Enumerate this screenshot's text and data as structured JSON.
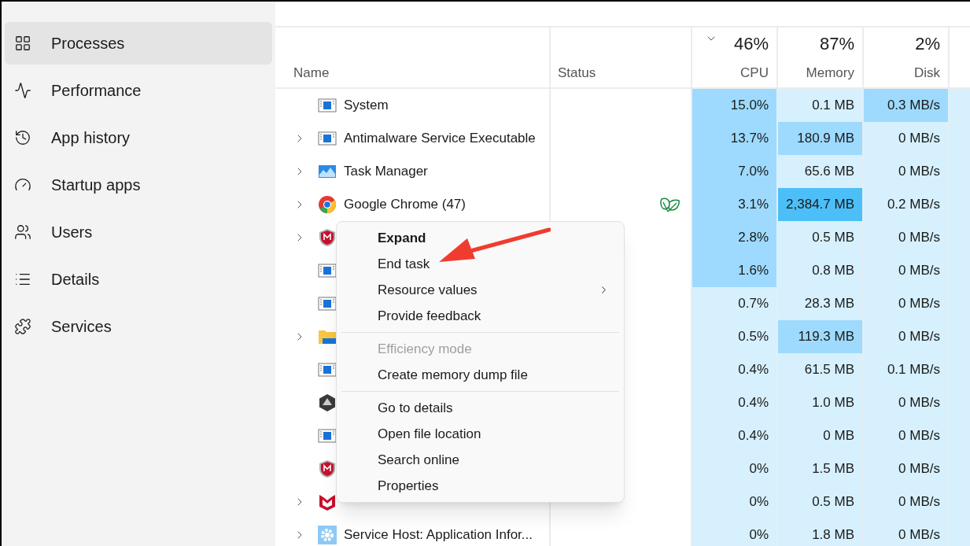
{
  "sidebar": {
    "items": [
      {
        "label": "Processes",
        "selected": true
      },
      {
        "label": "Performance",
        "selected": false
      },
      {
        "label": "App history",
        "selected": false
      },
      {
        "label": "Startup apps",
        "selected": false
      },
      {
        "label": "Users",
        "selected": false
      },
      {
        "label": "Details",
        "selected": false
      },
      {
        "label": "Services",
        "selected": false
      }
    ]
  },
  "table": {
    "columns": [
      {
        "label": "Name",
        "kind": "name"
      },
      {
        "label": "Status",
        "kind": "status"
      },
      {
        "label": "CPU",
        "total": "46%",
        "kind": "metric",
        "sorted": true
      },
      {
        "label": "Memory",
        "total": "87%",
        "kind": "metric",
        "sorted": false
      },
      {
        "label": "Disk",
        "total": "2%",
        "kind": "metric",
        "sorted": false
      }
    ],
    "rows": [
      {
        "name": "System",
        "kind": "window",
        "expandable": false,
        "efficiency": false,
        "cpu": {
          "text": "15.0%",
          "color": "#9edafd"
        },
        "memory": {
          "text": "0.1 MB",
          "color": "#d6f0fd"
        },
        "disk": {
          "text": "0.3 MB/s",
          "color": "#9edafd"
        }
      },
      {
        "name": "Antimalware Service Executable",
        "kind": "window",
        "expandable": true,
        "efficiency": false,
        "cpu": {
          "text": "13.7%",
          "color": "#9edafd"
        },
        "memory": {
          "text": "180.9 MB",
          "color": "#9edafd"
        },
        "disk": {
          "text": "0 MB/s",
          "color": "#d6f0fd"
        }
      },
      {
        "name": "Task Manager",
        "kind": "chart",
        "expandable": true,
        "efficiency": false,
        "cpu": {
          "text": "7.0%",
          "color": "#9edafd"
        },
        "memory": {
          "text": "65.6 MB",
          "color": "#d6f0fd"
        },
        "disk": {
          "text": "0 MB/s",
          "color": "#d6f0fd"
        }
      },
      {
        "name": "Google Chrome (47)",
        "kind": "browser",
        "expandable": true,
        "efficiency": true,
        "cpu": {
          "text": "3.1%",
          "color": "#9edafd"
        },
        "memory": {
          "text": "2,384.7 MB",
          "color": "#4dbff8"
        },
        "disk": {
          "text": "0.2 MB/s",
          "color": "#d6f0fd"
        }
      },
      {
        "kind": "shield",
        "expandable": true,
        "efficiency": false,
        "cpu": {
          "text": "2.8%",
          "color": "#9edafd"
        },
        "memory": {
          "text": "0.5 MB",
          "color": "#d6f0fd"
        },
        "disk": {
          "text": "0 MB/s",
          "color": "#d6f0fd"
        }
      },
      {
        "kind": "window",
        "expandable": false,
        "efficiency": false,
        "cpu": {
          "text": "1.6%",
          "color": "#9edafd"
        },
        "memory": {
          "text": "0.8 MB",
          "color": "#d6f0fd"
        },
        "disk": {
          "text": "0 MB/s",
          "color": "#d6f0fd"
        }
      },
      {
        "kind": "window",
        "expandable": false,
        "efficiency": false,
        "cpu": {
          "text": "0.7%",
          "color": "#d6f0fd"
        },
        "memory": {
          "text": "28.3 MB",
          "color": "#d6f0fd"
        },
        "disk": {
          "text": "0 MB/s",
          "color": "#d6f0fd"
        }
      },
      {
        "kind": "folder",
        "expandable": true,
        "efficiency": false,
        "cpu": {
          "text": "0.5%",
          "color": "#d6f0fd"
        },
        "memory": {
          "text": "119.3 MB",
          "color": "#9edafd"
        },
        "disk": {
          "text": "0 MB/s",
          "color": "#d6f0fd"
        }
      },
      {
        "kind": "window",
        "expandable": false,
        "efficiency": false,
        "cpu": {
          "text": "0.4%",
          "color": "#d6f0fd"
        },
        "memory": {
          "text": "61.5 MB",
          "color": "#d6f0fd"
        },
        "disk": {
          "text": "0.1 MB/s",
          "color": "#d6f0fd"
        }
      },
      {
        "kind": "hexagon",
        "expandable": false,
        "efficiency": false,
        "cpu": {
          "text": "0.4%",
          "color": "#d6f0fd"
        },
        "memory": {
          "text": "1.0 MB",
          "color": "#d6f0fd"
        },
        "disk": {
          "text": "0 MB/s",
          "color": "#d6f0fd"
        }
      },
      {
        "kind": "window",
        "expandable": false,
        "efficiency": false,
        "cpu": {
          "text": "0.4%",
          "color": "#d6f0fd"
        },
        "memory": {
          "text": "0 MB",
          "color": "#d6f0fd"
        },
        "disk": {
          "text": "0 MB/s",
          "color": "#d6f0fd"
        }
      },
      {
        "kind": "shield",
        "expandable": false,
        "efficiency": false,
        "cpu": {
          "text": "0%",
          "color": "#d6f0fd"
        },
        "memory": {
          "text": "1.5 MB",
          "color": "#d6f0fd"
        },
        "disk": {
          "text": "0 MB/s",
          "color": "#d6f0fd"
        }
      },
      {
        "kind": "m",
        "expandable": true,
        "efficiency": false,
        "cpu": {
          "text": "0%",
          "color": "#d6f0fd"
        },
        "memory": {
          "text": "0.5 MB",
          "color": "#d6f0fd"
        },
        "disk": {
          "text": "0 MB/s",
          "color": "#d6f0fd"
        }
      },
      {
        "name": "Service Host: Application Infor...",
        "kind": "gear",
        "expandable": true,
        "efficiency": false,
        "cpu": {
          "text": "0%",
          "color": "#d6f0fd"
        },
        "memory": {
          "text": "1.8 MB",
          "color": "#d6f0fd"
        },
        "disk": {
          "text": "0 MB/s",
          "color": "#d6f0fd"
        }
      }
    ]
  },
  "context_menu": {
    "groups": [
      [
        {
          "label": "Expand",
          "default": true,
          "disabled": false,
          "submenu": false
        },
        {
          "label": "End task",
          "default": false,
          "disabled": false,
          "submenu": false
        },
        {
          "label": "Resource values",
          "default": false,
          "disabled": false,
          "submenu": true
        },
        {
          "label": "Provide feedback",
          "default": false,
          "disabled": false,
          "submenu": false
        }
      ],
      [
        {
          "label": "Efficiency mode",
          "default": false,
          "disabled": true,
          "submenu": false
        },
        {
          "label": "Create memory dump file",
          "default": false,
          "disabled": false,
          "submenu": false
        }
      ],
      [
        {
          "label": "Go to details",
          "default": false,
          "disabled": false,
          "submenu": false
        },
        {
          "label": "Open file location",
          "default": false,
          "disabled": false,
          "submenu": false
        },
        {
          "label": "Search online",
          "default": false,
          "disabled": false,
          "submenu": false
        },
        {
          "label": "Properties",
          "default": false,
          "disabled": false,
          "submenu": false
        }
      ]
    ]
  }
}
